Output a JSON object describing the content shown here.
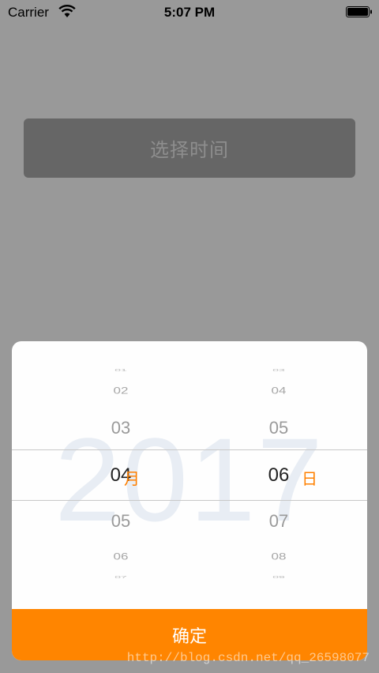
{
  "status_bar": {
    "carrier": "Carrier",
    "time": "5:07 PM"
  },
  "pick_button": {
    "label": "选择时间"
  },
  "picker": {
    "year": "2017",
    "month": {
      "edge_above": "01",
      "far_above": "02",
      "near_above": "03",
      "selected": "04",
      "near_below": "05",
      "far_below": "06",
      "edge_below": "07",
      "unit": "月"
    },
    "day": {
      "edge_above": "03",
      "far_above": "04",
      "near_above": "05",
      "selected": "06",
      "near_below": "07",
      "far_below": "08",
      "edge_below": "09",
      "unit": "日"
    },
    "confirm_label": "确定"
  },
  "watermark": "http://blog.csdn.net/qq_26598077",
  "colors": {
    "accent": "#ff8500",
    "background": "#999999",
    "button_bg": "#666666"
  }
}
